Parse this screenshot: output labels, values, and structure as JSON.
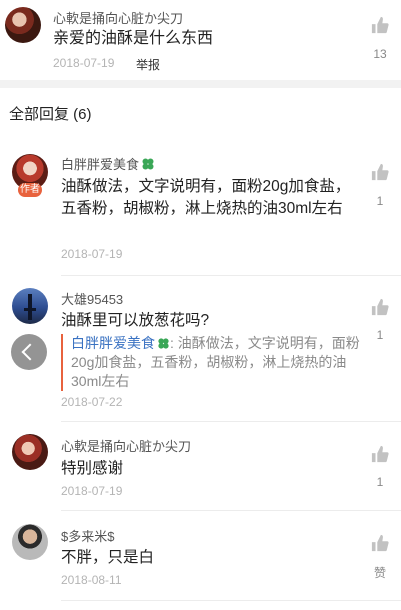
{
  "post": {
    "author": "心軟是捅向心脏か尖刀",
    "content": "亲爱的油酥是什么东西",
    "date": "2018-07-19",
    "report_label": "举报",
    "like_count": "13"
  },
  "replies_header": {
    "title": "全部回复 (6)"
  },
  "replies": [
    {
      "author": "白胖胖爱美食",
      "badge": "作者",
      "content": "油酥做法，文字说明有，面粉20g加食盐，五香粉，胡椒粉，淋上烧热的油30ml左右",
      "date": "2018-07-19",
      "like_count": "1"
    },
    {
      "author": "大雄95453",
      "content": "油酥里可以放葱花吗?",
      "quote_author": "白胖胖爱美食",
      "quote_text": ": 油酥做法，文字说明有，面粉20g加食盐，五香粉，胡椒粉，淋上烧热的油30ml左右",
      "date": "2018-07-22",
      "like_count": "1"
    },
    {
      "author": "心軟是捅向心脏か尖刀",
      "content": "特别感谢",
      "date": "2018-07-19",
      "like_count": "1"
    },
    {
      "author": "$多来米$",
      "content": "不胖，只是白",
      "date": "2018-08-11",
      "like_count": "赞"
    }
  ],
  "colors": {
    "accent": "#e8623d",
    "link": "#3a72c2",
    "clover": "#3aa757"
  },
  "icons": {
    "like": "thumbs-up-icon",
    "back": "chevron-left-icon",
    "clover": "clover-icon"
  }
}
